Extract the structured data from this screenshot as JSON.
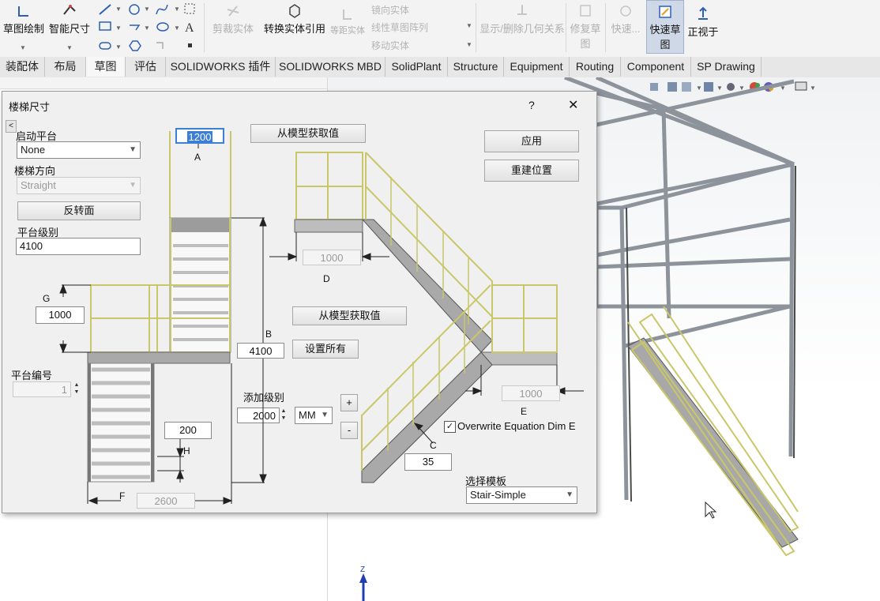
{
  "ribbon": {
    "sketch": "草图绘制",
    "smart_dim": "智能尺寸",
    "trim": "剪裁实体",
    "convert": "转换实体引用",
    "offset": "等距实体",
    "mirror": "镜向实体",
    "linear_pattern": "线性草图阵列",
    "move": "移动实体",
    "relations": "显示/删除几何关系",
    "repair": "修复草图",
    "quick_snaps": "快速...",
    "rapid_sketch": "快速草图",
    "normal_to": "正视于"
  },
  "tabs": [
    "装配体",
    "布局",
    "草图",
    "评估",
    "SOLIDWORKS 插件",
    "SOLIDWORKS MBD",
    "SolidPlant",
    "Structure",
    "Equipment",
    "Routing",
    "Component",
    "SP Drawing"
  ],
  "active_tab": "草图",
  "dialog": {
    "title": "楼梯尺寸",
    "help": "?",
    "close": "✕",
    "collapse": "<",
    "start_platform_label": "启动平台",
    "start_platform_value": "None",
    "direction_label": "楼梯方向",
    "direction_value": "Straight",
    "flip_button": "反转面",
    "platform_level_label": "平台级别",
    "platform_level_value": "4100",
    "platform_number_label": "平台编号",
    "platform_number_value": "1",
    "apply_button": "应用",
    "rebuild_button": "重建位置",
    "get_from_model_1": "从模型获取值",
    "get_from_model_2": "从模型获取值",
    "set_all_button": "设置所有",
    "add_level_label": "添加级别",
    "add_level_value": "2000",
    "unit_value": "MM",
    "plus": "+",
    "minus": "-",
    "overwrite_label": "Overwrite Equation Dim E",
    "template_label": "选择模板",
    "template_value": "Stair-Simple",
    "dims": {
      "A_value": "1200",
      "A": "A",
      "B_value": "4100",
      "B": "B",
      "C_value": "35",
      "C": "C",
      "D_value": "1000",
      "D": "D",
      "E_value": "1000",
      "E": "E",
      "F_value": "2600",
      "F": "F",
      "G_value": "1000",
      "G": "G",
      "H_value": "200",
      "H": "H"
    }
  },
  "colors": {
    "rail": "#c9c76a",
    "steel": "#7d7d7d",
    "frame": "#9097a0"
  },
  "triad": {
    "z": "Z"
  }
}
